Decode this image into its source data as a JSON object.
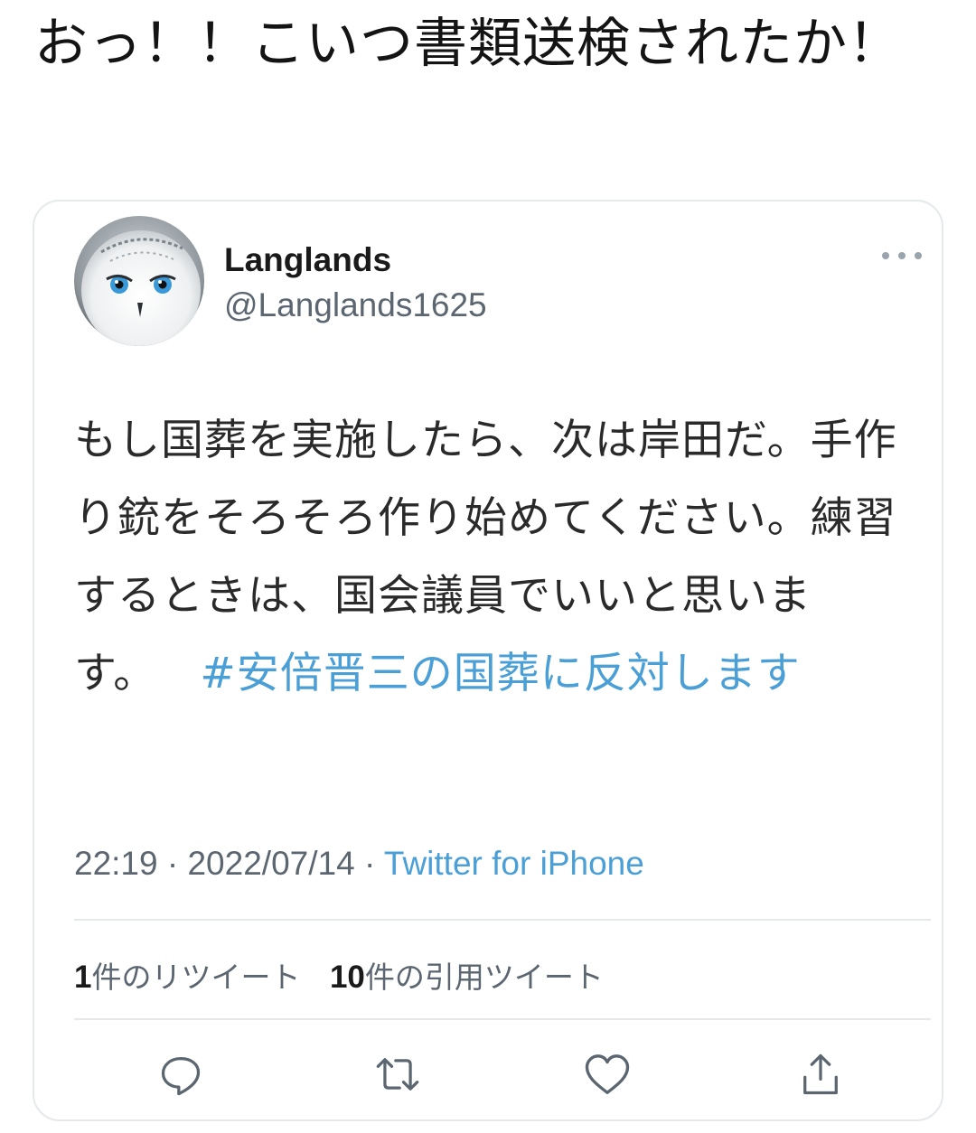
{
  "post": {
    "text": "おっ！！こいつ書類送検されたか！"
  },
  "tweet": {
    "author": {
      "name": "Langlands",
      "handle": "@Langlands1625",
      "avatar_icon": "snowy-owl-avatar"
    },
    "body": {
      "text": "もし国葬を実施したら、次は岸田だ。手作り銃をそろそろ作り始めてください。練習するときは、国会議員でいいと思います。",
      "hashtag": "#安倍晋三の国葬に反対します"
    },
    "meta": {
      "time": "22:19",
      "separator": "·",
      "date": "2022/07/14",
      "source": "Twitter for iPhone"
    },
    "stats": {
      "retweets_count": "1",
      "retweets_label": "件のリツイート",
      "quotes_count": "10",
      "quotes_label": "件の引用ツイート"
    },
    "actions": [
      {
        "icon": "reply-icon"
      },
      {
        "icon": "retweet-icon"
      },
      {
        "icon": "like-icon"
      },
      {
        "icon": "share-icon"
      }
    ],
    "colors": {
      "link": "#4a9fd6",
      "secondary_text": "#5b6670",
      "border": "#e6e9ec"
    }
  }
}
